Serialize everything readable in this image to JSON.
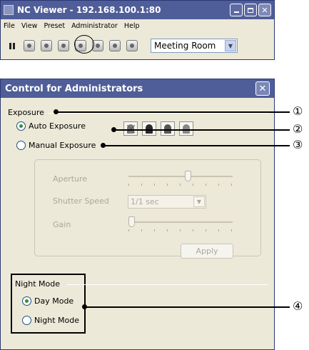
{
  "viewer": {
    "title": "NC Viewer - 192.168.100.1:80",
    "menu": [
      "File",
      "View",
      "Preset",
      "Administrator",
      "Help"
    ],
    "camera_select": "Meeting Room"
  },
  "dialog": {
    "title": "Control for Administrators",
    "close_glyph": "✕",
    "exposure": {
      "header": "Exposure",
      "auto_label": "Auto Exposure",
      "manual_label": "Manual Exposure",
      "selected": "auto"
    },
    "manual": {
      "aperture_label": "Aperture",
      "aperture_level": 0.58,
      "shutter_label": "Shutter Speed",
      "shutter_value": "1/1 sec",
      "gain_label": "Gain",
      "gain_level": 0.0,
      "apply_label": "Apply"
    },
    "night": {
      "header": "Night Mode",
      "day_label": "Day Mode",
      "night_label": "Night Mode",
      "selected": "day"
    }
  },
  "callouts": [
    "①",
    "②",
    "③",
    "④"
  ],
  "icons": {
    "viewer_app": "nc-viewer-icon",
    "toolbar": [
      "pause-icon",
      "signal-icon",
      "preset-icon",
      "settings-icon",
      "admin-icon",
      "snapshot-icon",
      "sound-icon",
      "pen-icon"
    ],
    "exposure_buttons": [
      "exposure-auto-off-icon",
      "exposure-dark-icon",
      "exposure-normal-icon",
      "exposure-bright-icon"
    ]
  }
}
